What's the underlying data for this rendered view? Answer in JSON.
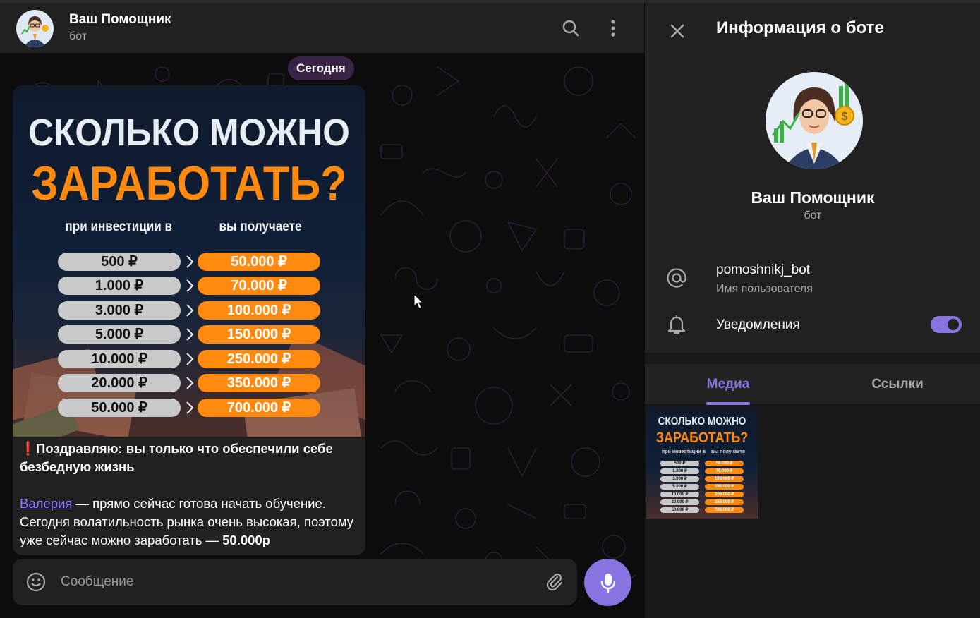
{
  "chat": {
    "title": "Ваш Помощник",
    "subtitle": "бот",
    "date_label": "Сегодня",
    "message": {
      "promo_title_line1": "СКОЛЬКО МОЖНО",
      "promo_title_line2": "ЗАРАБОТАТЬ?",
      "col_invest": "при инвестиции в",
      "col_receive": "вы получаете",
      "rows": [
        {
          "invest": "500 ₽",
          "receive": "50.000 ₽"
        },
        {
          "invest": "1.000 ₽",
          "receive": "70.000 ₽"
        },
        {
          "invest": "3.000 ₽",
          "receive": "100.000 ₽"
        },
        {
          "invest": "5.000 ₽",
          "receive": "150.000 ₽"
        },
        {
          "invest": "10.000 ₽",
          "receive": "250.000 ₽"
        },
        {
          "invest": "20.000 ₽",
          "receive": "350.000 ₽"
        },
        {
          "invest": "50.000 ₽",
          "receive": "700.000 ₽"
        }
      ],
      "line1_emoji": "❗",
      "line1_bold": "Поздравляю: вы только что обеспечили себе безбедную жизнь",
      "mention": "Валерия",
      "line2_rest_a": " — прямо сейчас готова начать обучение. Сегодня волатильность рынка очень высокая, поэтому уже сейчас можно заработать — ",
      "line2_amount": "50.000р"
    },
    "composer": {
      "placeholder": "Сообщение"
    }
  },
  "info_panel": {
    "title": "Информация о боте",
    "name": "Ваш Помощник",
    "type": "бот",
    "username": "pomoshnikj_bot",
    "username_caption": "Имя пользователя",
    "notifications_label": "Уведомления",
    "notifications_on": true,
    "tabs": [
      {
        "label": "Медиа",
        "active": true
      },
      {
        "label": "Ссылки",
        "active": false
      }
    ]
  },
  "colors": {
    "accent": "#8774e1",
    "orange": "#ff8a0f",
    "panel": "#212121",
    "background": "#181818"
  },
  "icons": [
    "search-icon",
    "more-vertical-icon",
    "close-icon",
    "at-icon",
    "bell-icon",
    "emoji-icon",
    "attach-icon",
    "mic-icon"
  ]
}
